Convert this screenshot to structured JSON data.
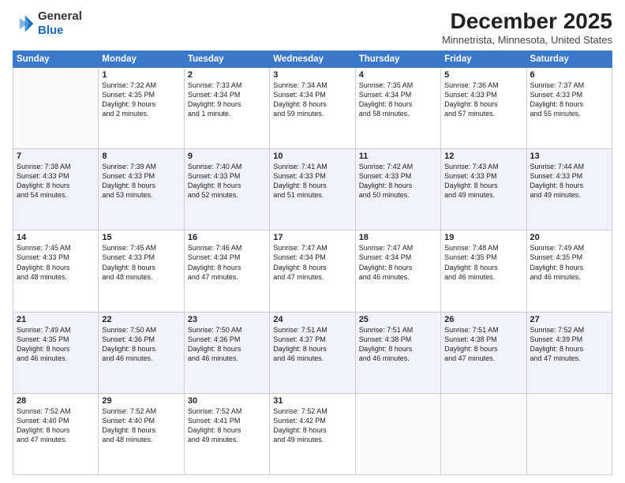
{
  "header": {
    "logo_line1": "General",
    "logo_line2": "Blue",
    "month_title": "December 2025",
    "subtitle": "Minnetrista, Minnesota, United States"
  },
  "days_of_week": [
    "Sunday",
    "Monday",
    "Tuesday",
    "Wednesday",
    "Thursday",
    "Friday",
    "Saturday"
  ],
  "weeks": [
    [
      {
        "day": "",
        "info": ""
      },
      {
        "day": "1",
        "info": "Sunrise: 7:32 AM\nSunset: 4:35 PM\nDaylight: 9 hours\nand 2 minutes."
      },
      {
        "day": "2",
        "info": "Sunrise: 7:33 AM\nSunset: 4:34 PM\nDaylight: 9 hours\nand 1 minute."
      },
      {
        "day": "3",
        "info": "Sunrise: 7:34 AM\nSunset: 4:34 PM\nDaylight: 8 hours\nand 59 minutes."
      },
      {
        "day": "4",
        "info": "Sunrise: 7:35 AM\nSunset: 4:34 PM\nDaylight: 8 hours\nand 58 minutes."
      },
      {
        "day": "5",
        "info": "Sunrise: 7:36 AM\nSunset: 4:33 PM\nDaylight: 8 hours\nand 57 minutes."
      },
      {
        "day": "6",
        "info": "Sunrise: 7:37 AM\nSunset: 4:33 PM\nDaylight: 8 hours\nand 55 minutes."
      }
    ],
    [
      {
        "day": "7",
        "info": "Sunrise: 7:38 AM\nSunset: 4:33 PM\nDaylight: 8 hours\nand 54 minutes."
      },
      {
        "day": "8",
        "info": "Sunrise: 7:39 AM\nSunset: 4:33 PM\nDaylight: 8 hours\nand 53 minutes."
      },
      {
        "day": "9",
        "info": "Sunrise: 7:40 AM\nSunset: 4:33 PM\nDaylight: 8 hours\nand 52 minutes."
      },
      {
        "day": "10",
        "info": "Sunrise: 7:41 AM\nSunset: 4:33 PM\nDaylight: 8 hours\nand 51 minutes."
      },
      {
        "day": "11",
        "info": "Sunrise: 7:42 AM\nSunset: 4:33 PM\nDaylight: 8 hours\nand 50 minutes."
      },
      {
        "day": "12",
        "info": "Sunrise: 7:43 AM\nSunset: 4:33 PM\nDaylight: 8 hours\nand 49 minutes."
      },
      {
        "day": "13",
        "info": "Sunrise: 7:44 AM\nSunset: 4:33 PM\nDaylight: 8 hours\nand 49 minutes."
      }
    ],
    [
      {
        "day": "14",
        "info": "Sunrise: 7:45 AM\nSunset: 4:33 PM\nDaylight: 8 hours\nand 48 minutes."
      },
      {
        "day": "15",
        "info": "Sunrise: 7:45 AM\nSunset: 4:33 PM\nDaylight: 8 hours\nand 48 minutes."
      },
      {
        "day": "16",
        "info": "Sunrise: 7:46 AM\nSunset: 4:34 PM\nDaylight: 8 hours\nand 47 minutes."
      },
      {
        "day": "17",
        "info": "Sunrise: 7:47 AM\nSunset: 4:34 PM\nDaylight: 8 hours\nand 47 minutes."
      },
      {
        "day": "18",
        "info": "Sunrise: 7:47 AM\nSunset: 4:34 PM\nDaylight: 8 hours\nand 46 minutes."
      },
      {
        "day": "19",
        "info": "Sunrise: 7:48 AM\nSunset: 4:35 PM\nDaylight: 8 hours\nand 46 minutes."
      },
      {
        "day": "20",
        "info": "Sunrise: 7:49 AM\nSunset: 4:35 PM\nDaylight: 8 hours\nand 46 minutes."
      }
    ],
    [
      {
        "day": "21",
        "info": "Sunrise: 7:49 AM\nSunset: 4:35 PM\nDaylight: 8 hours\nand 46 minutes."
      },
      {
        "day": "22",
        "info": "Sunrise: 7:50 AM\nSunset: 4:36 PM\nDaylight: 8 hours\nand 46 minutes."
      },
      {
        "day": "23",
        "info": "Sunrise: 7:50 AM\nSunset: 4:36 PM\nDaylight: 8 hours\nand 46 minutes."
      },
      {
        "day": "24",
        "info": "Sunrise: 7:51 AM\nSunset: 4:37 PM\nDaylight: 8 hours\nand 46 minutes."
      },
      {
        "day": "25",
        "info": "Sunrise: 7:51 AM\nSunset: 4:38 PM\nDaylight: 8 hours\nand 46 minutes."
      },
      {
        "day": "26",
        "info": "Sunrise: 7:51 AM\nSunset: 4:38 PM\nDaylight: 8 hours\nand 47 minutes."
      },
      {
        "day": "27",
        "info": "Sunrise: 7:52 AM\nSunset: 4:39 PM\nDaylight: 8 hours\nand 47 minutes."
      }
    ],
    [
      {
        "day": "28",
        "info": "Sunrise: 7:52 AM\nSunset: 4:40 PM\nDaylight: 8 hours\nand 47 minutes."
      },
      {
        "day": "29",
        "info": "Sunrise: 7:52 AM\nSunset: 4:40 PM\nDaylight: 8 hours\nand 48 minutes."
      },
      {
        "day": "30",
        "info": "Sunrise: 7:52 AM\nSunset: 4:41 PM\nDaylight: 8 hours\nand 49 minutes."
      },
      {
        "day": "31",
        "info": "Sunrise: 7:52 AM\nSunset: 4:42 PM\nDaylight: 8 hours\nand 49 minutes."
      },
      {
        "day": "",
        "info": ""
      },
      {
        "day": "",
        "info": ""
      },
      {
        "day": "",
        "info": ""
      }
    ]
  ]
}
